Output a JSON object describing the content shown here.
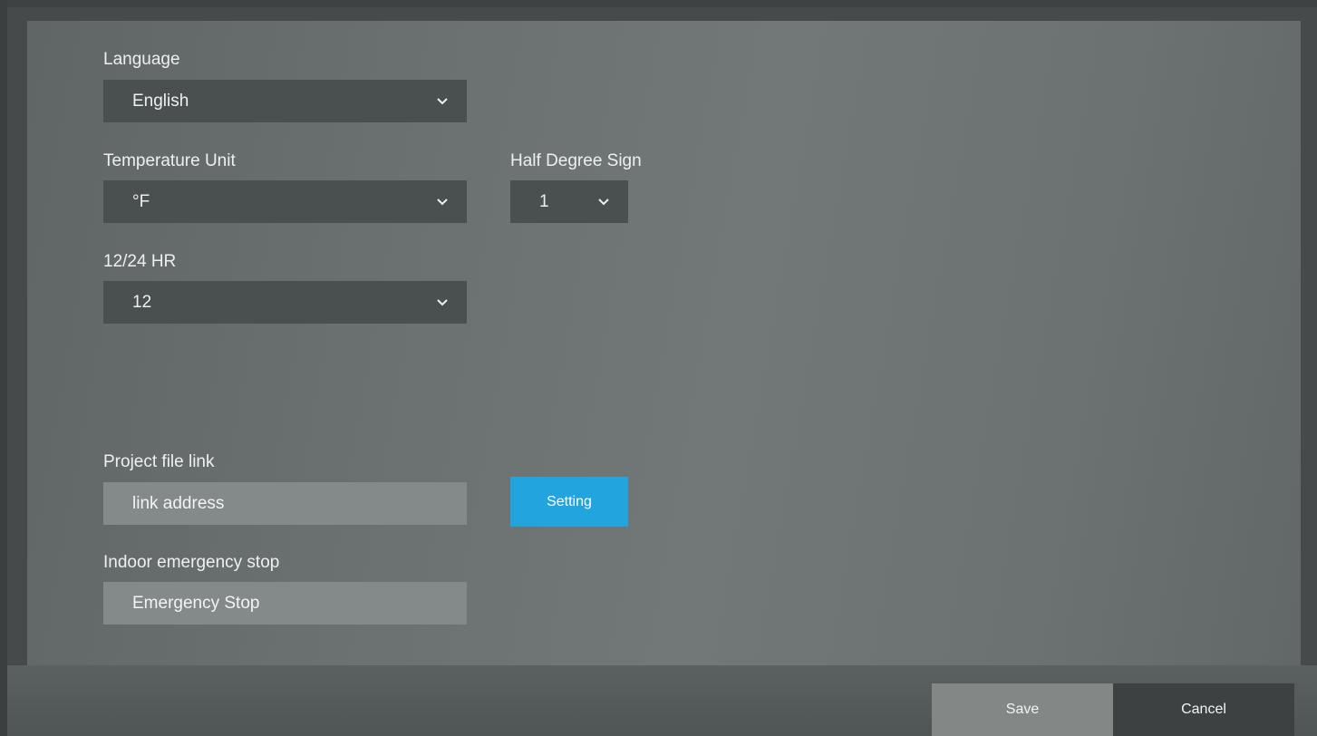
{
  "settings": {
    "language": {
      "label": "Language",
      "value": "English"
    },
    "temperature_unit": {
      "label": "Temperature Unit",
      "value": "°F"
    },
    "half_degree_sign": {
      "label": "Half Degree Sign",
      "value": "1"
    },
    "hour_format": {
      "label": "12/24 HR",
      "value": "12"
    },
    "project_file_link": {
      "label": "Project file link",
      "value": "link address",
      "button_label": "Setting"
    },
    "indoor_emergency_stop": {
      "label": "Indoor emergency stop",
      "value": "Emergency Stop"
    }
  },
  "footer": {
    "save_label": "Save",
    "cancel_label": "Cancel"
  },
  "colors": {
    "accent": "#22a4de",
    "panel": "#6b7171",
    "select_bg": "#4a4f50",
    "textbox_bg": "#838a89",
    "save_bg": "#838887",
    "cancel_bg": "#3d4142"
  },
  "icons": {
    "dropdown": "chevron-down-icon"
  }
}
